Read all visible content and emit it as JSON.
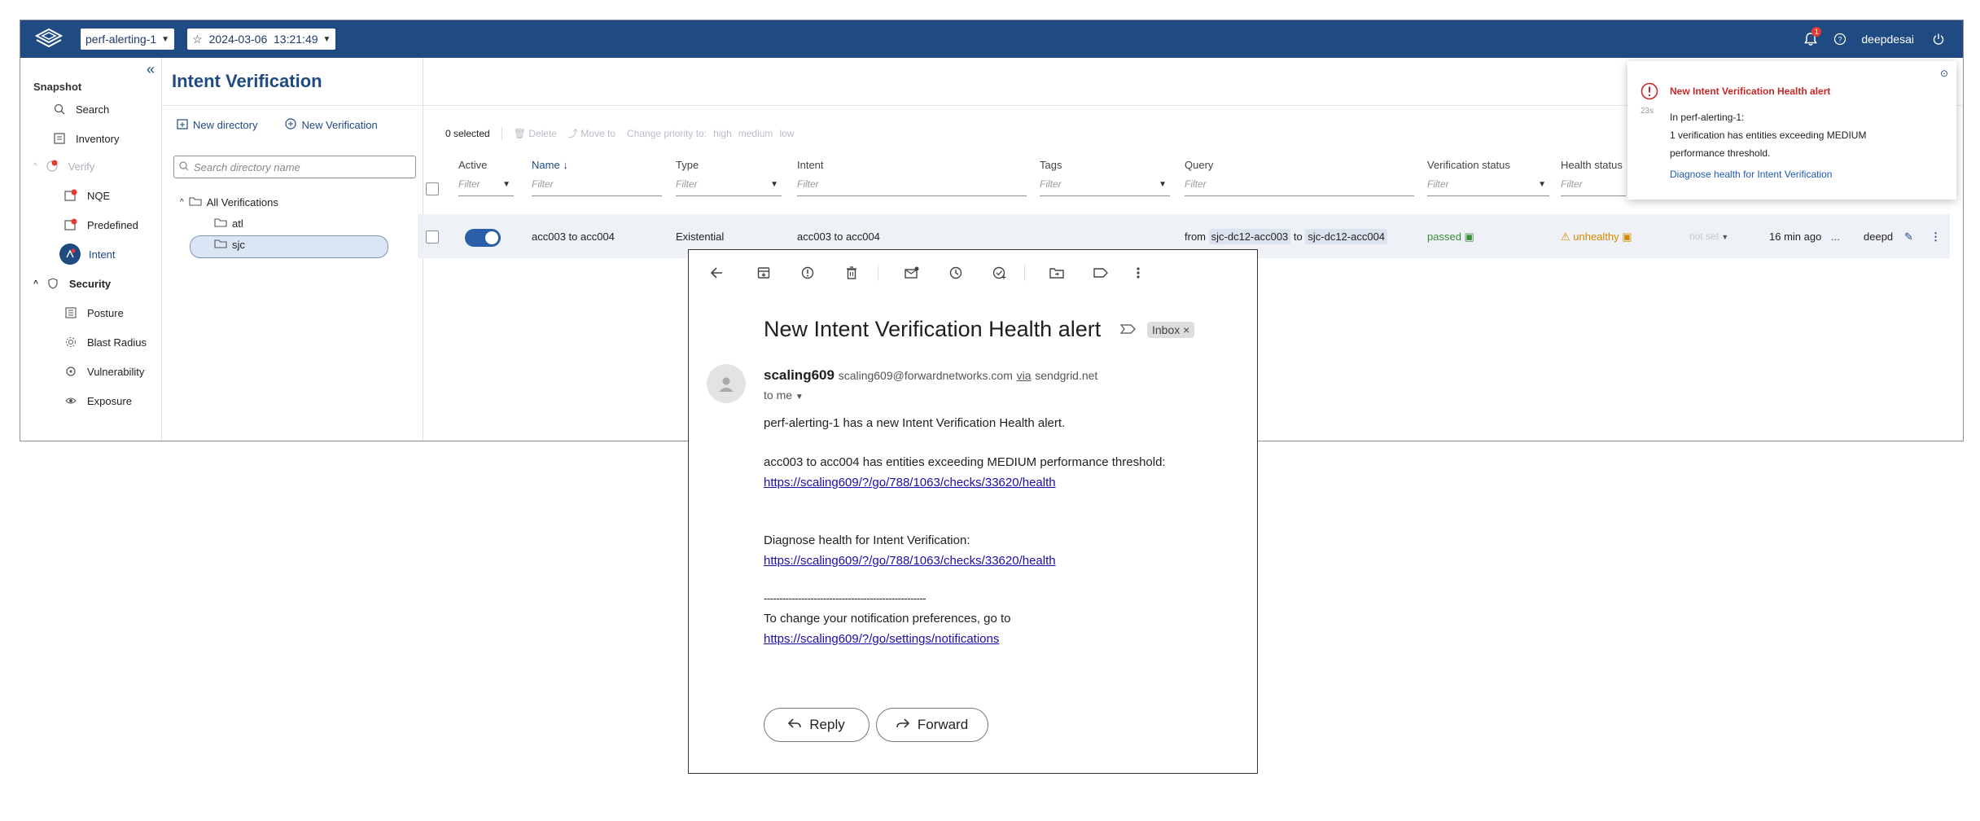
{
  "topbar": {
    "network": "perf-alerting-1",
    "snapshot": "2024-03-06  13:21:49",
    "bell_count": "1",
    "user": "deepdesai"
  },
  "nav": {
    "section": "Snapshot",
    "items": [
      {
        "label": "Search"
      },
      {
        "label": "Inventory"
      },
      {
        "label": "Verify"
      },
      {
        "label": "NQE"
      },
      {
        "label": "Predefined"
      },
      {
        "label": "Intent"
      },
      {
        "label": "Security"
      },
      {
        "label": "Posture"
      },
      {
        "label": "Blast Radius"
      },
      {
        "label": "Vulnerability"
      },
      {
        "label": "Exposure"
      }
    ]
  },
  "page": {
    "title": "Intent Verification"
  },
  "dir": {
    "new_directory": "New directory",
    "new_verification": "New Verification",
    "search_placeholder": "Search directory name",
    "tree": [
      "All Verifications",
      "atl",
      "sjc"
    ]
  },
  "toolbar": {
    "selected": "0 selected",
    "delete": "Delete",
    "move_to": "Move to",
    "change_priority": "Change priority to:",
    "high": "high",
    "medium": "medium",
    "low": "low"
  },
  "table": {
    "columns": [
      "Active",
      "Name",
      "Type",
      "Intent",
      "Tags",
      "Query",
      "Verification status",
      "Health status"
    ],
    "filter_placeholder": "Filter",
    "row": {
      "name": "acc003 to acc004",
      "type": "Existential",
      "intent": "acc003 to acc004",
      "query_from": "from",
      "query_src": "sjc-dc12-acc003",
      "query_to": "to",
      "query_dst": "sjc-dc12-acc004",
      "verification": "passed",
      "health": "unhealthy",
      "priority": "not set",
      "modified": "16 min ago",
      "more": "...",
      "owner": "deepd"
    }
  },
  "toast": {
    "title": "New Intent Verification Health alert",
    "age": "23s",
    "line1": "In perf-alerting-1:",
    "line2": "1 verification has entities exceeding MEDIUM",
    "line3": "performance threshold.",
    "link": "Diagnose health for Intent Verification"
  },
  "email": {
    "subject": "New Intent Verification Health alert",
    "label": "Inbox",
    "sender_name": "scaling609",
    "sender_addr": "scaling609@forwardnetworks.com",
    "via": "via",
    "via_domain": "sendgrid.net",
    "to": "to me",
    "body1": "perf-alerting-1 has a new Intent Verification Health alert.",
    "body2": "acc003 to acc004 has entities exceeding MEDIUM performance threshold:",
    "link1": "https://scaling609/?/go/788/1063/checks/33620/health",
    "body3": "Diagnose health for Intent Verification:",
    "link2": "https://scaling609/?/go/788/1063/checks/33620/health",
    "divider": "----------------------------------------------------",
    "body4": "To change your notification preferences, go to",
    "link3": "https://scaling609/?/go/settings/notifications",
    "reply": "Reply",
    "forward": "Forward"
  }
}
